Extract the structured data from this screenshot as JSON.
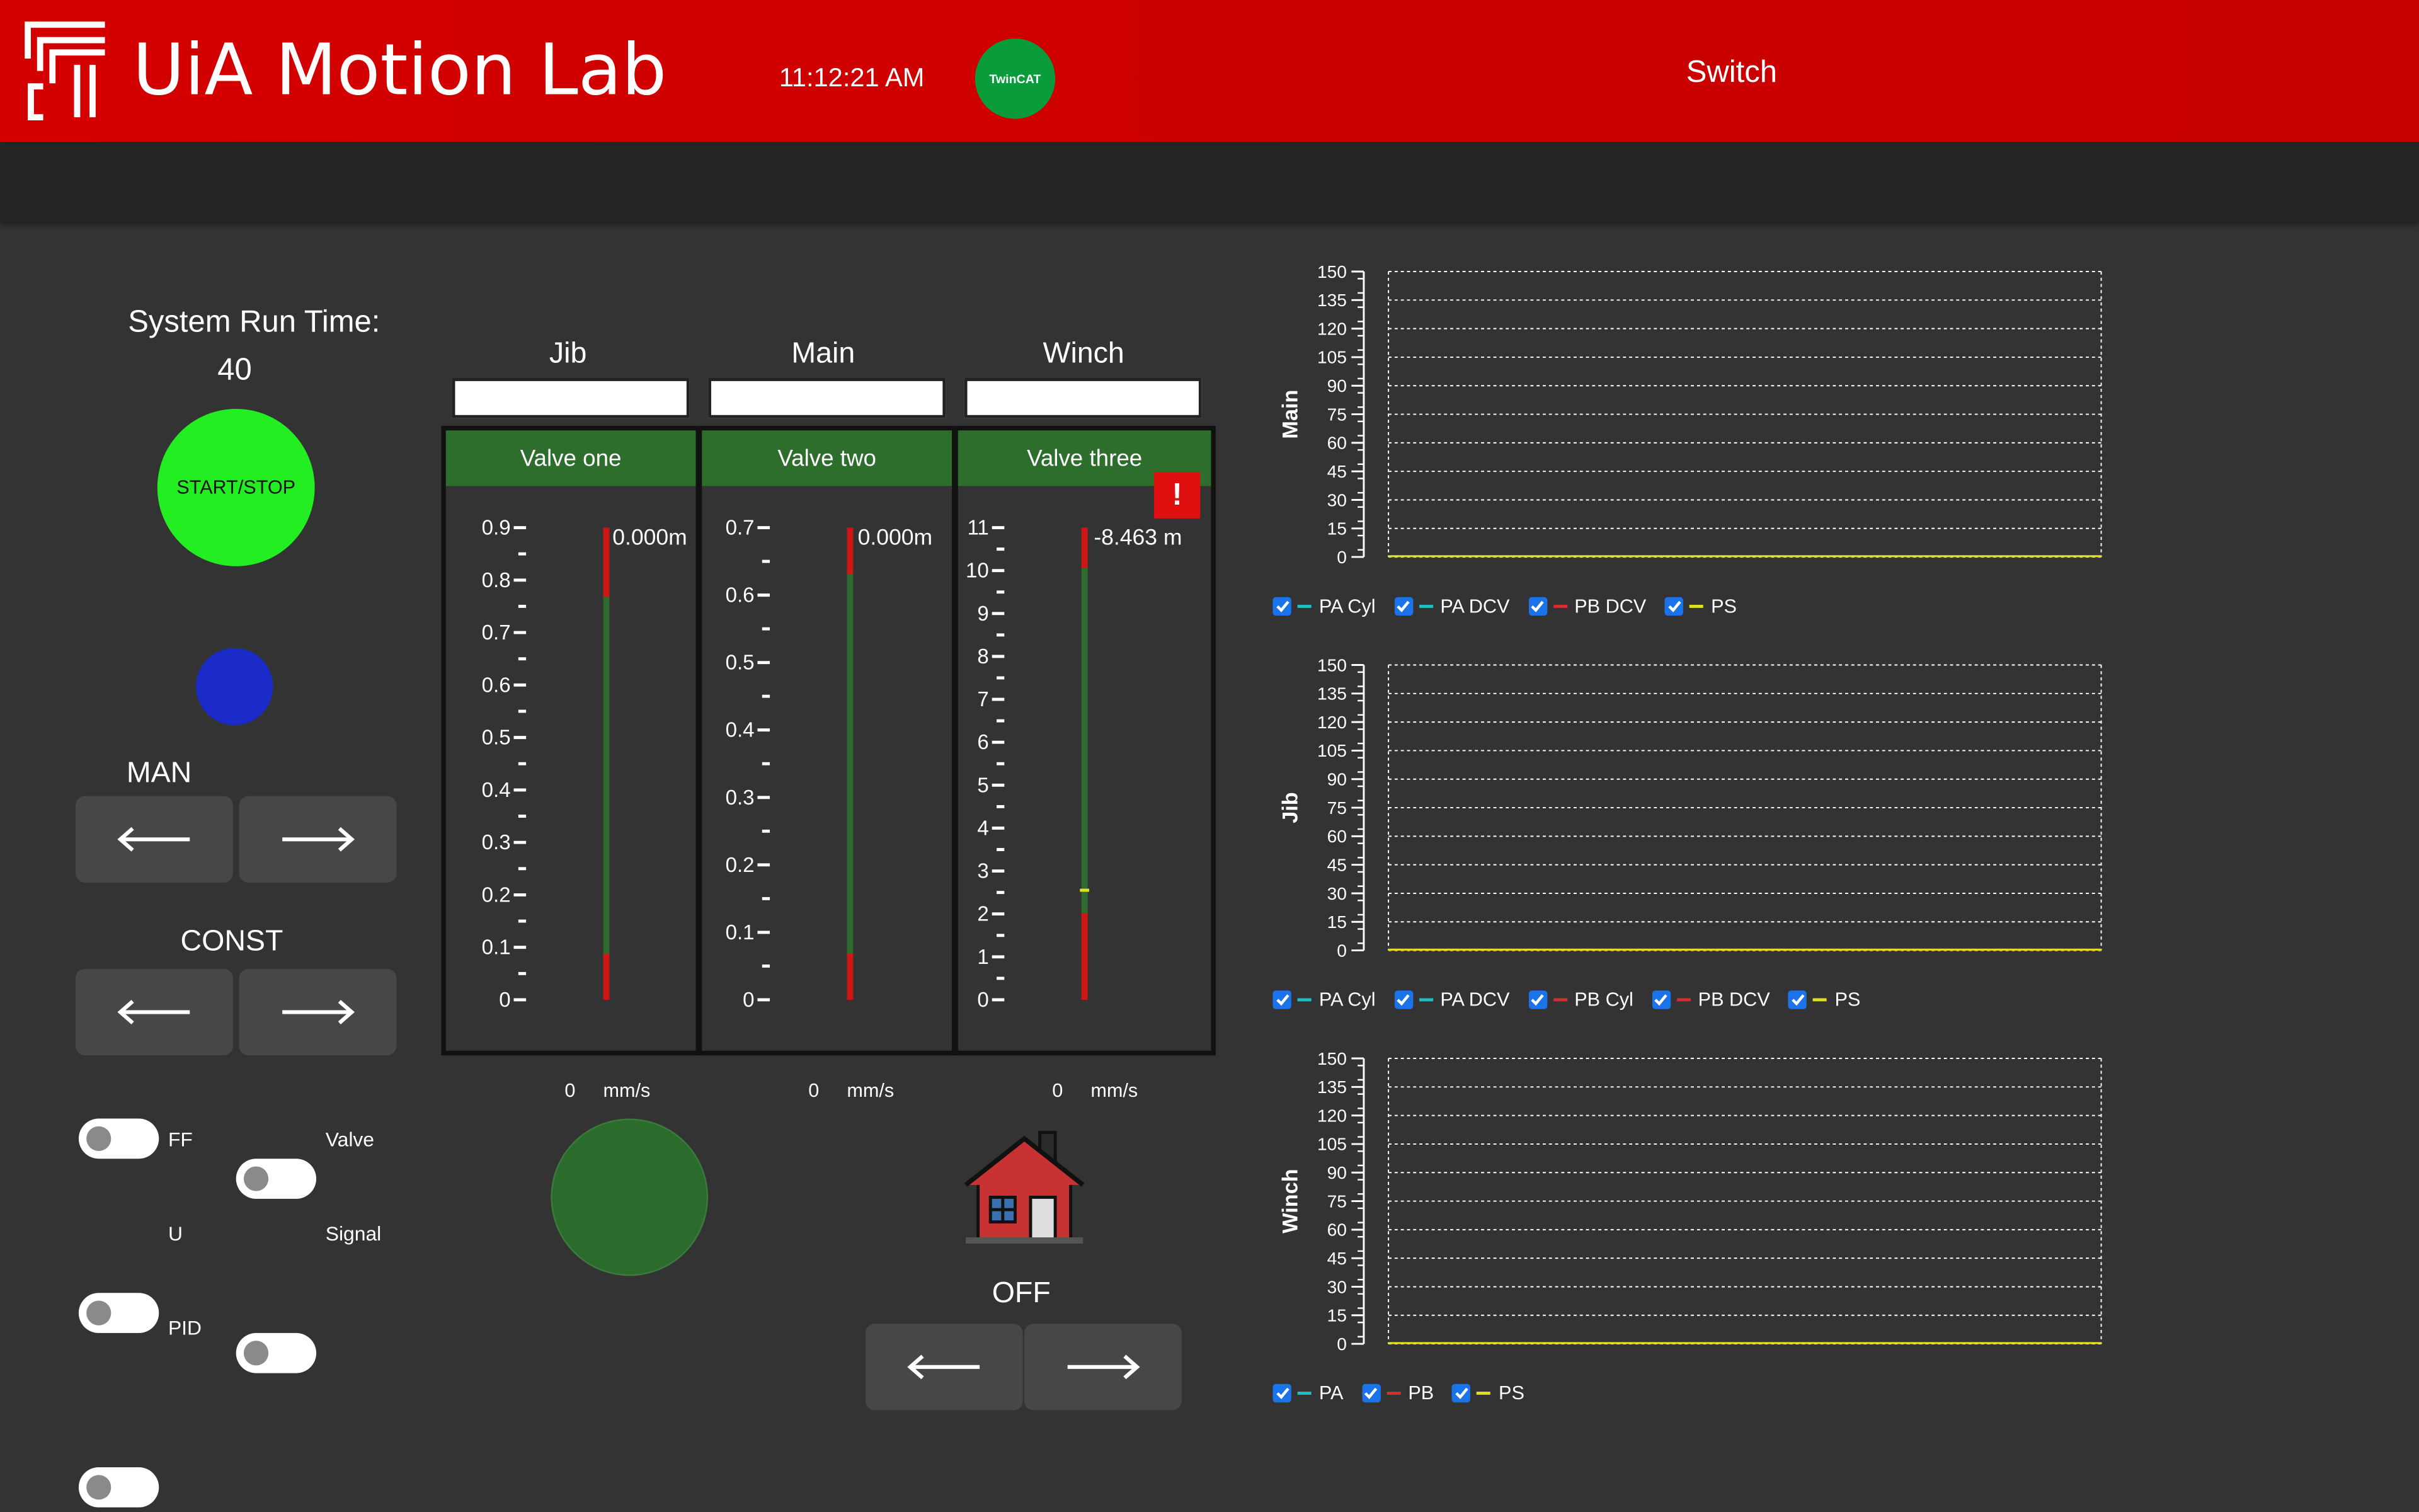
{
  "header": {
    "brand": "UiA Motion Lab",
    "clock": "11:12:21 AM",
    "twincat_label": "TwinCAT",
    "switch_label": "Switch"
  },
  "left": {
    "run_time_label": "System Run Time:",
    "run_time_value": "40",
    "start_stop_label": "START/STOP",
    "man_label": "MAN",
    "const_label": "CONST",
    "toggles": [
      {
        "label": "FF"
      },
      {
        "label": "Valve"
      },
      {
        "label": "U"
      },
      {
        "label": "Signal"
      },
      {
        "label": "PID"
      }
    ]
  },
  "valves": [
    {
      "title": "Jib",
      "header": "Valve one",
      "readout": "0.000",
      "unit": "m",
      "speed": "0",
      "speed_unit": "mm/s",
      "ticks": [
        "0.9",
        "0.8",
        "0.7",
        "0.6",
        "0.5",
        "0.4",
        "0.3",
        "0.2",
        "0.1",
        "0"
      ]
    },
    {
      "title": "Main",
      "header": "Valve two",
      "readout": "0.000",
      "unit": "m",
      "speed": "0",
      "speed_unit": "mm/s",
      "ticks": [
        "0.7",
        "0.6",
        "0.5",
        "0.4",
        "0.3",
        "0.2",
        "0.1",
        "0"
      ]
    },
    {
      "title": "Winch",
      "header": "Valve three",
      "readout": "-8.463",
      "unit": "m",
      "speed": "0",
      "speed_unit": "mm/s",
      "ticks": [
        "11",
        "10",
        "9",
        "8",
        "7",
        "6",
        "5",
        "4",
        "3",
        "2",
        "1",
        "0"
      ]
    }
  ],
  "alert_icon": "exclamation-icon",
  "home": {
    "icon": "house-icon",
    "status": "OFF"
  },
  "colors": {
    "header_red": "#cc0000",
    "valve_header_green": "#2d6e2d",
    "start_green": "#22ee22",
    "indicator_blue": "#1a2bc8",
    "gauge_red": "#d01515",
    "gauge_green": "#2f6a2f",
    "status_circle_green": "#2b6b2b",
    "series_cyan": "#20c0c0",
    "series_red": "#d03030",
    "series_yellow": "#e0e020"
  },
  "chart_data": [
    {
      "type": "line",
      "ylabel": "Main",
      "ylim": [
        0,
        150
      ],
      "yticks": [
        "150",
        "135",
        "120",
        "105",
        "90",
        "75",
        "60",
        "45",
        "30",
        "15",
        "0"
      ],
      "grid": true,
      "legend_position": "bottom",
      "series": [
        {
          "name": "PA Cyl",
          "color": "#20c0c0",
          "values": [
            0,
            0
          ]
        },
        {
          "name": "PA DCV",
          "color": "#20c0c0",
          "values": [
            0,
            0
          ]
        },
        {
          "name": "PB DCV",
          "color": "#d03030",
          "values": [
            0,
            0
          ]
        },
        {
          "name": "PS",
          "color": "#e0e020",
          "values": [
            0,
            0
          ]
        }
      ]
    },
    {
      "type": "line",
      "ylabel": "Jib",
      "ylim": [
        0,
        150
      ],
      "yticks": [
        "150",
        "135",
        "120",
        "105",
        "90",
        "75",
        "60",
        "45",
        "30",
        "15",
        "0"
      ],
      "grid": true,
      "legend_position": "bottom",
      "series": [
        {
          "name": "PA Cyl",
          "color": "#20c0c0",
          "values": [
            0,
            0
          ]
        },
        {
          "name": "PA DCV",
          "color": "#20c0c0",
          "values": [
            0,
            0
          ]
        },
        {
          "name": "PB Cyl",
          "color": "#d03030",
          "values": [
            0,
            0
          ]
        },
        {
          "name": "PB DCV",
          "color": "#d03030",
          "values": [
            0,
            0
          ]
        },
        {
          "name": "PS",
          "color": "#e0e020",
          "values": [
            0,
            0
          ]
        }
      ]
    },
    {
      "type": "line",
      "ylabel": "Winch",
      "ylim": [
        0,
        150
      ],
      "yticks": [
        "150",
        "135",
        "120",
        "105",
        "90",
        "75",
        "60",
        "45",
        "30",
        "15",
        "0"
      ],
      "grid": true,
      "legend_position": "bottom",
      "series": [
        {
          "name": "PA",
          "color": "#20c0c0",
          "values": [
            0,
            0
          ]
        },
        {
          "name": "PB",
          "color": "#d03030",
          "values": [
            0,
            0
          ]
        },
        {
          "name": "PS",
          "color": "#e0e020",
          "values": [
            0,
            0
          ]
        }
      ]
    }
  ]
}
